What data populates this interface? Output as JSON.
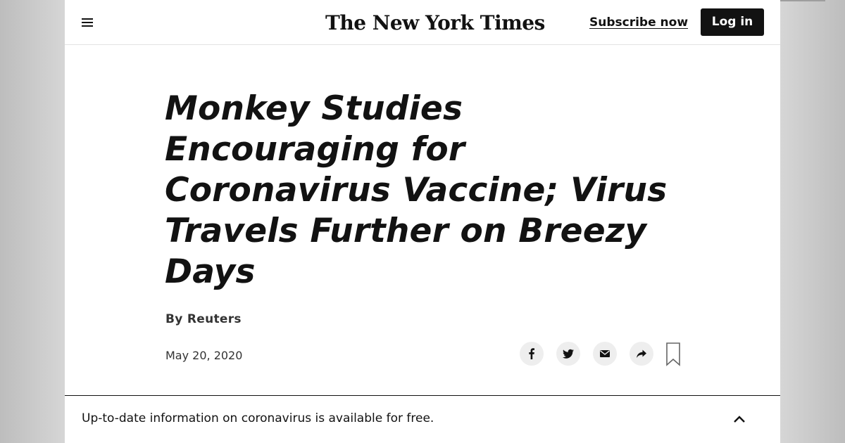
{
  "header": {
    "logo_text": "The New York Times",
    "subscribe_label": "Subscribe now",
    "login_label": "Log in",
    "menu_icon": "hamburger-menu-icon"
  },
  "article": {
    "headline": "Monkey Studies Encouraging for Coronavirus Vaccine; Virus Travels Further on Breezy Days",
    "byline": "By Reuters",
    "date": "May 20, 2020"
  },
  "share_tools": [
    {
      "icon": "facebook-icon"
    },
    {
      "icon": "twitter-icon"
    },
    {
      "icon": "email-icon"
    },
    {
      "icon": "share-arrow-icon"
    },
    {
      "icon": "bookmark-icon"
    }
  ],
  "banner": {
    "text": "Up-to-date information on coronavirus is available for free.",
    "toggle_icon": "chevron-up-icon"
  }
}
